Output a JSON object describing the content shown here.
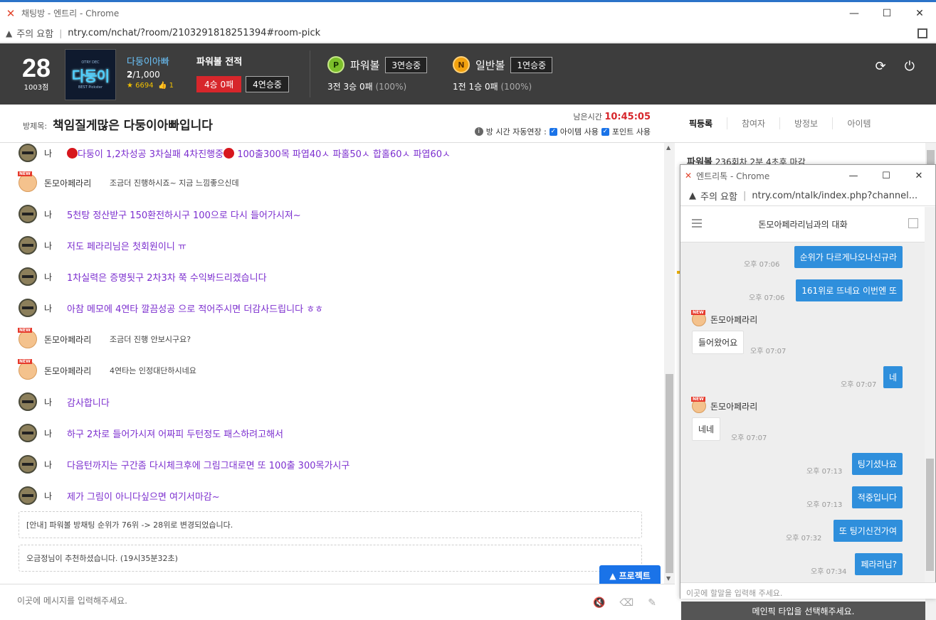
{
  "browser": {
    "window_title": "채팅방 - 엔트리 - Chrome",
    "not_secure": "주의 요함",
    "url": "ntry.com/nchat/?room/2103291818251394#room-pick"
  },
  "header": {
    "rank": "28",
    "points": "1003점",
    "avatar_small": "OTRY DEC",
    "avatar_big": "다둥이",
    "avatar_tag": "BEST Pickster",
    "username": "다둥이아빠",
    "member_count_cur": "2",
    "member_count_max": "/1,000",
    "star_count": "6694",
    "like_count": "1",
    "power_record_title": "파워볼 전적",
    "record_badge": "4승 0패",
    "record_streak": "4연승중",
    "powerball": {
      "icon": "P",
      "name": "파워볼",
      "streak": "3연승중",
      "record": "3전 3승 0패",
      "pct": "(100%)"
    },
    "normalball": {
      "icon": "N",
      "name": "일반볼",
      "streak": "1연승중",
      "record": "1전 1승 0패",
      "pct": "(100%)"
    }
  },
  "room": {
    "label": "방제목:",
    "title": "책임질게많은 다둥이아빠입니다",
    "time_label": "남은시간",
    "time_value": "10:45:05",
    "opt_auto": "방 시간 자동연장 :",
    "opt_item": "아이템 사용",
    "opt_point": "포인트 사용"
  },
  "tabs": [
    "픽등록",
    "참여자",
    "방정보",
    "아이템"
  ],
  "messages": [
    {
      "who": "me",
      "nick": "나",
      "text": "다둥이 1,2차성공 3차실패 4차진행중",
      "text2": "100출300목 파엽40ㅅ 파홀50ㅅ 합홀60ㅅ 파엽60ㅅ"
    },
    {
      "who": "other",
      "nick": "돈모아페라리",
      "text": "조금더 진행하시죠~ 지금 느낌좋으신데"
    },
    {
      "who": "me",
      "nick": "나",
      "text": "5천탕 정산받구 150환전하시구 100으로 다시 들어가시져~"
    },
    {
      "who": "me",
      "nick": "나",
      "text": "저도 페라리님은 첫회원이니 ㅠ"
    },
    {
      "who": "me",
      "nick": "나",
      "text": "1차실력은 증명됫구 2차3차 쭉 수익봐드리겠습니다"
    },
    {
      "who": "me",
      "nick": "나",
      "text": "아참 메모에 4연타 깔끔성공 으로 적어주시면 더감사드립니다 ㅎㅎ"
    },
    {
      "who": "other",
      "nick": "돈모아페라리",
      "text": "조금더 진행 안보시구요?"
    },
    {
      "who": "other",
      "nick": "돈모아페라리",
      "text": "4연타는 인정대단하시네요"
    },
    {
      "who": "me",
      "nick": "나",
      "text": "감사합니다"
    },
    {
      "who": "me",
      "nick": "나",
      "text": "하구 2차로 들어가시져 어짜피 두턴정도 패스하려고해서"
    },
    {
      "who": "me",
      "nick": "나",
      "text": "다음턴까지는 구간좀 다시체크후에 그림그대로면 또 100출 300목가시구"
    },
    {
      "who": "me",
      "nick": "나",
      "text": "제가 그림이 아니다싶으면 여기서마감~"
    }
  ],
  "notices": [
    "[안내] 파워볼 방채팅 순위가 76위 -> 28위로 변경되었습니다.",
    "오금정님이 추천하셨습니다. (19시35분32초)"
  ],
  "project_button": "▲ 프로젝트",
  "input_placeholder": "이곳에 메시지를 입력해주세요.",
  "right_panel": {
    "pick_info_bold": "파워볼",
    "pick_info": "236회차 2분 4초후 마감",
    "bottom_bar": "메인픽 타입을 선택해주세요."
  },
  "popup": {
    "window_title": "엔트리톡 - Chrome",
    "not_secure": "주의 요함",
    "url": "ntry.com/ntalk/index.php?channel...",
    "chat_title": "돈모아페라리님과의 대화",
    "input_placeholder": "이곳에 할말을 입력해 주세요.",
    "messages": [
      {
        "side": "right",
        "text": "순위가 다르게나오나신규라",
        "time": "오후 07:06"
      },
      {
        "side": "right",
        "text": "161위로 뜨네요 이번엔 또",
        "time": "오후 07:06"
      },
      {
        "side": "left",
        "sender": "돈모아페라리",
        "text": "들어왔어요",
        "time": "오후 07:07"
      },
      {
        "side": "right",
        "text": "네",
        "time": "오후 07:07"
      },
      {
        "side": "left",
        "sender": "돈모아페라리",
        "text": "네네",
        "time": "오후 07:07"
      },
      {
        "side": "right",
        "text": "팅기셨나요",
        "time": "오후 07:13"
      },
      {
        "side": "right",
        "text": "적중입니다",
        "time": "오후 07:13"
      },
      {
        "side": "right",
        "text": "또 팅기신건가여",
        "time": "오후 07:32"
      },
      {
        "side": "right",
        "text": "페라리님?",
        "time": "오후 07:34"
      }
    ]
  }
}
